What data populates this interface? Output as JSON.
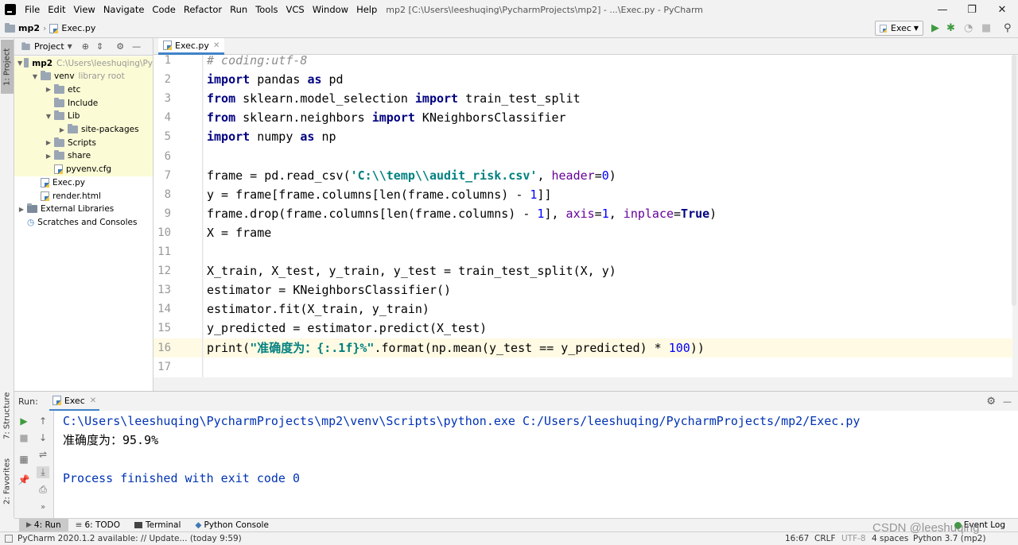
{
  "window": {
    "title": "mp2 [C:\\Users\\leeshuqing\\PycharmProjects\\mp2] - ...\\Exec.py - PyCharm",
    "menu": [
      "File",
      "Edit",
      "View",
      "Navigate",
      "Code",
      "Refactor",
      "Run",
      "Tools",
      "VCS",
      "Window",
      "Help"
    ],
    "minimize_icon": "minimize-icon",
    "maximize_icon": "restore-icon",
    "close_icon": "close-icon"
  },
  "navbar": {
    "breadcrumb": [
      "mp2",
      "Exec.py"
    ],
    "run_config": "Exec"
  },
  "sidebar_left": {
    "project_tab": "1: Project",
    "structure_tab": "7: Structure",
    "favorites_tab": "2: Favorites"
  },
  "project_panel": {
    "title": "Project",
    "tree": [
      {
        "label": "mp2",
        "extra": "C:\\Users\\leeshuqing\\Py",
        "level": 0,
        "type": "folder",
        "expanded": true,
        "bold": true
      },
      {
        "label": "venv",
        "extra": "library root",
        "level": 1,
        "type": "folder",
        "expanded": true
      },
      {
        "label": "etc",
        "extra": "",
        "level": 2,
        "type": "folder",
        "expanded": false
      },
      {
        "label": "Include",
        "extra": "",
        "level": 2,
        "type": "folder",
        "expanded": null
      },
      {
        "label": "Lib",
        "extra": "",
        "level": 2,
        "type": "folder",
        "expanded": true
      },
      {
        "label": "site-packages",
        "extra": "",
        "level": 3,
        "type": "folder",
        "expanded": false
      },
      {
        "label": "Scripts",
        "extra": "",
        "level": 2,
        "type": "folder",
        "expanded": false
      },
      {
        "label": "share",
        "extra": "",
        "level": 2,
        "type": "folder",
        "expanded": false
      },
      {
        "label": "pyvenv.cfg",
        "extra": "",
        "level": 2,
        "type": "file",
        "expanded": null
      },
      {
        "label": "Exec.py",
        "extra": "",
        "level": 1,
        "type": "pyfile",
        "expanded": null
      },
      {
        "label": "render.html",
        "extra": "",
        "level": 1,
        "type": "file",
        "expanded": null
      },
      {
        "label": "External Libraries",
        "extra": "",
        "level": 0,
        "type": "lib",
        "expanded": false
      },
      {
        "label": "Scratches and Consoles",
        "extra": "",
        "level": 0,
        "type": "scratch",
        "expanded": null
      }
    ]
  },
  "editor": {
    "tab": "Exec.py",
    "current_line": 16,
    "lines": [
      [
        {
          "t": "# coding:utf-8",
          "c": "cm"
        }
      ],
      [
        {
          "t": "import",
          "c": "kw"
        },
        {
          "t": " pandas "
        },
        {
          "t": "as",
          "c": "kw"
        },
        {
          "t": " pd"
        }
      ],
      [
        {
          "t": "from",
          "c": "kw"
        },
        {
          "t": " sklearn.model_selection "
        },
        {
          "t": "import",
          "c": "kw"
        },
        {
          "t": " train_test_split"
        }
      ],
      [
        {
          "t": "from",
          "c": "kw"
        },
        {
          "t": " sklearn.neighbors "
        },
        {
          "t": "import",
          "c": "kw"
        },
        {
          "t": " KNeighborsClassifier"
        }
      ],
      [
        {
          "t": "import",
          "c": "kw"
        },
        {
          "t": " numpy "
        },
        {
          "t": "as",
          "c": "kw"
        },
        {
          "t": " np"
        }
      ],
      [],
      [
        {
          "t": "frame = pd.read_csv("
        },
        {
          "t": "'C:\\\\temp\\\\audit_risk.csv'",
          "c": "str"
        },
        {
          "t": ", "
        },
        {
          "t": "header",
          "c": "kwarg"
        },
        {
          "t": "="
        },
        {
          "t": "0",
          "c": "num"
        },
        {
          "t": ")"
        }
      ],
      [
        {
          "t": "y = frame[frame.columns[len(frame.columns) - "
        },
        {
          "t": "1",
          "c": "num"
        },
        {
          "t": "]]"
        }
      ],
      [
        {
          "t": "frame.drop(frame.columns[len(frame.columns) - "
        },
        {
          "t": "1",
          "c": "num"
        },
        {
          "t": "], "
        },
        {
          "t": "axis",
          "c": "kwarg"
        },
        {
          "t": "="
        },
        {
          "t": "1",
          "c": "num"
        },
        {
          "t": ", "
        },
        {
          "t": "inplace",
          "c": "kwarg"
        },
        {
          "t": "="
        },
        {
          "t": "True",
          "c": "kw"
        },
        {
          "t": ")"
        }
      ],
      [
        {
          "t": "X = frame"
        }
      ],
      [],
      [
        {
          "t": "X_train, X_test, y_train, y_test = train_test_split(X, y)"
        }
      ],
      [
        {
          "t": "estimator = KNeighborsClassifier()"
        }
      ],
      [
        {
          "t": "estimator.fit(X_train, y_train)"
        }
      ],
      [
        {
          "t": "y_predicted = estimator.predict(X_test)"
        }
      ],
      [
        {
          "t": "print("
        },
        {
          "t": "\"准确度为：{:.1f}%\"",
          "c": "str"
        },
        {
          "t": ".format(np.mean(y_test == y_predicted) * "
        },
        {
          "t": "100",
          "c": "num"
        },
        {
          "t": "))"
        }
      ],
      []
    ]
  },
  "run_panel": {
    "label": "Run:",
    "tab": "Exec",
    "output": [
      {
        "text": "C:\\Users\\leeshuqing\\PycharmProjects\\mp2\\venv\\Scripts\\python.exe C:/Users/leeshuqing/PycharmProjects/mp2/Exec.py",
        "color": "#0033b3"
      },
      {
        "text": "准确度为：95.9%",
        "color": "#000000"
      },
      {
        "text": "",
        "color": "#000000"
      },
      {
        "text": "Process finished with exit code 0",
        "color": "#0033b3"
      }
    ]
  },
  "bottom_tabs": [
    {
      "label": "4: Run",
      "icon": "play-icon"
    },
    {
      "label": "6: TODO",
      "icon": "list-icon"
    },
    {
      "label": "Terminal",
      "icon": "terminal-icon"
    },
    {
      "label": "Python Console",
      "icon": "python-icon"
    }
  ],
  "event_log": "Event Log",
  "status": {
    "message": "PyCharm 2020.1.2 available: // Update... (today 9:59)",
    "position": "16:67",
    "line_sep": "CRLF",
    "encoding": "UTF-8",
    "indent": "4 spaces",
    "interpreter": "Python 3.7 (mp2)"
  },
  "watermark": "CSDN @leeshuqing"
}
